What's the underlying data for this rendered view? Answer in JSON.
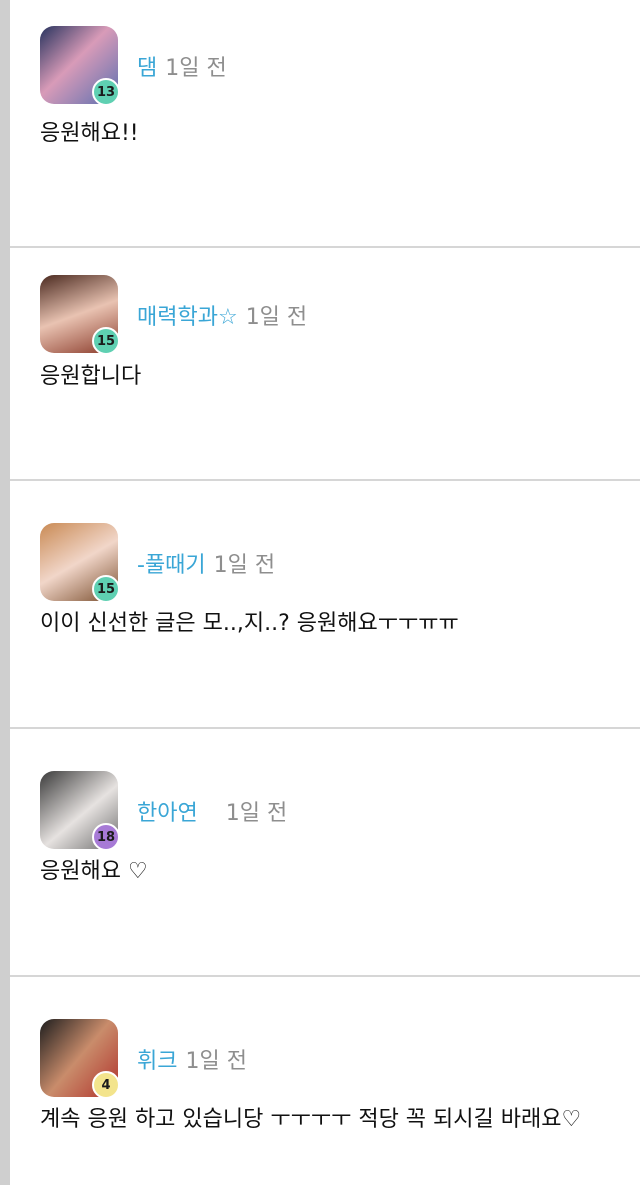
{
  "comments": [
    {
      "username": "댐",
      "time": "1일 전",
      "level": "13",
      "text": "응원해요!!",
      "badge_color": "#5fd0b2",
      "avatar_colors": [
        "#27335e",
        "#d89bb8",
        "#5a6fb0"
      ]
    },
    {
      "username": "매력학과☆",
      "time": "1일 전",
      "level": "15",
      "text": "응원합니다",
      "badge_color": "#5fd0b2",
      "avatar_colors": [
        "#4b2a20",
        "#e9c3b2",
        "#8a3b2b"
      ]
    },
    {
      "username": "-풀때기",
      "time": "1일 전",
      "level": "15",
      "text": "이이 신선한 글은 모..,지..? 응원해요ㅜㅜㅠㅠ",
      "badge_color": "#5fd0b2",
      "avatar_colors": [
        "#c98a54",
        "#f1d6c9",
        "#7a4e2e"
      ]
    },
    {
      "username": "한아연",
      "time": "1일 전",
      "level": "18",
      "text": "응원해요 ♡",
      "badge_color": "#a77ad6",
      "avatar_colors": [
        "#3a3a3a",
        "#e6e2e0",
        "#6d6d6d"
      ]
    },
    {
      "username": "휘크",
      "time": "1일 전",
      "level": "4",
      "text": "계속 응원 하고 있습니당 ㅜㅜㅜㅜ 적당 꼭 되시길 바래요♡",
      "badge_color": "#f3e48c",
      "avatar_colors": [
        "#1e1e1e",
        "#c98c6b",
        "#b0312b"
      ]
    }
  ]
}
